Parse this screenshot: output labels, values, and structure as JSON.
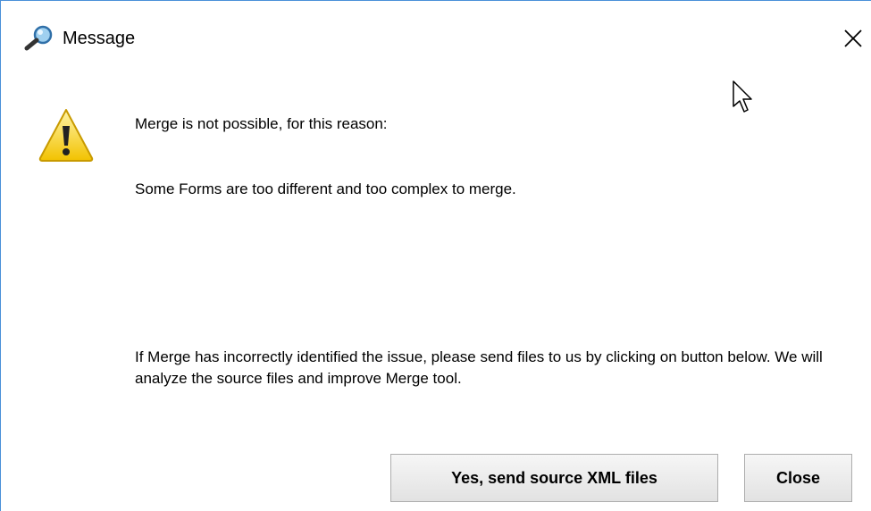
{
  "window": {
    "title": "Message",
    "app_icon": "magnifier-icon",
    "close_icon": "close-icon"
  },
  "message": {
    "icon": "warning-icon",
    "reason_label": "Merge is not possible, for this reason:",
    "detail": "Some Forms are too different and too complex to merge.",
    "info": "If Merge has incorrectly identified the issue, please send files to us by clicking on button below. We will analyze the source files and improve Merge tool."
  },
  "buttons": {
    "send_label": "Yes, send source XML files",
    "close_label": "Close"
  },
  "colors": {
    "border_accent": "#4a90d9",
    "warning_yellow": "#f5d12b",
    "button_border": "#adadad"
  }
}
